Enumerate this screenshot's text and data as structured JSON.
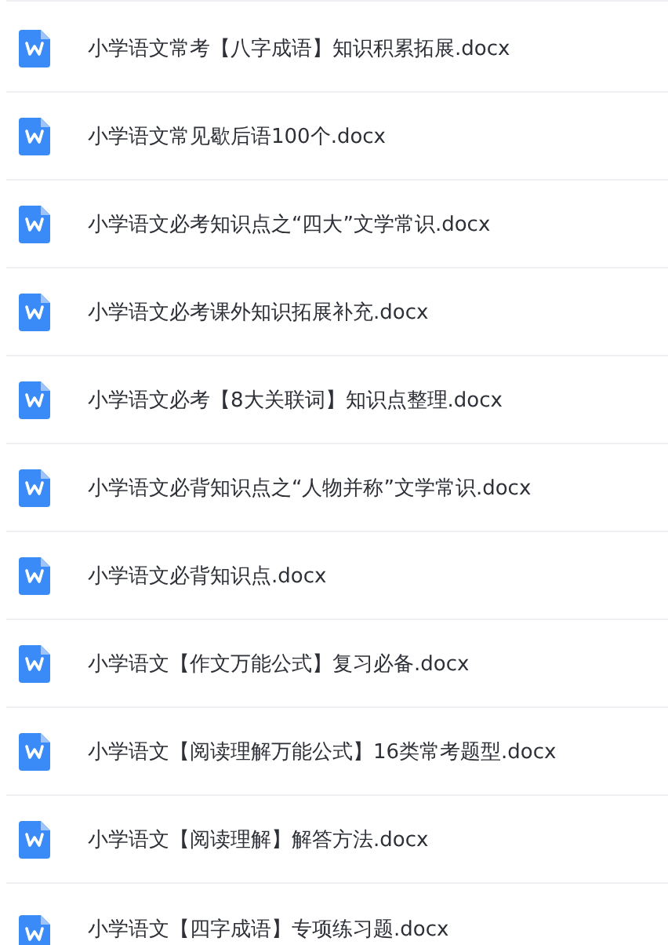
{
  "files": [
    {
      "name": "小学语文常考【八字成语】知识积累拓展.docx",
      "kind": "document"
    },
    {
      "name": "小学语文常见歇后语100个.docx",
      "kind": "document"
    },
    {
      "name": "小学语文必考知识点之“四大”文学常识.docx",
      "kind": "document"
    },
    {
      "name": "小学语文必考课外知识拓展补充.docx",
      "kind": "document"
    },
    {
      "name": "小学语文必考【8大关联词】知识点整理.docx",
      "kind": "document"
    },
    {
      "name": "小学语文必背知识点之“人物并称”文学常识.docx",
      "kind": "document"
    },
    {
      "name": "小学语文必背知识点.docx",
      "kind": "document"
    },
    {
      "name": "小学语文【作文万能公式】复习必备.docx",
      "kind": "document"
    },
    {
      "name": "小学语文【阅读理解万能公式】16类常考题型.docx",
      "kind": "document"
    },
    {
      "name": "小学语文【阅读理解】解答方法.docx",
      "kind": "document"
    },
    {
      "name": "小学语文【四字成语】专项练习题.docx",
      "kind": "document"
    }
  ]
}
